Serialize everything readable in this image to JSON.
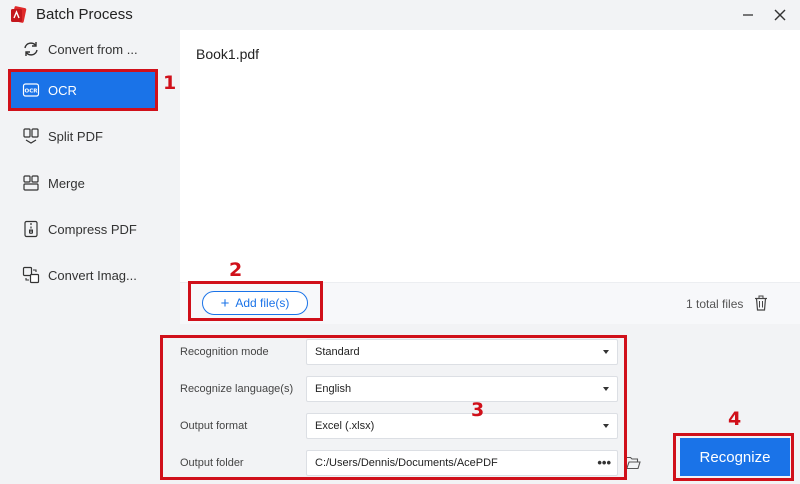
{
  "window": {
    "title": "Batch Process",
    "icons": {
      "logo": "app-logo-icon",
      "minimize": "minimize-icon",
      "close": "close-icon"
    }
  },
  "sidebar": {
    "items": [
      {
        "label": "Convert from ...",
        "icon": "convert-from-icon",
        "active": false
      },
      {
        "label": "OCR",
        "icon": "ocr-icon",
        "active": true
      },
      {
        "label": "Split PDF",
        "icon": "split-pdf-icon",
        "active": false
      },
      {
        "label": "Merge",
        "icon": "merge-icon",
        "active": false
      },
      {
        "label": "Compress PDF",
        "icon": "compress-pdf-icon",
        "active": false
      },
      {
        "label": "Convert Imag...",
        "icon": "convert-image-icon",
        "active": false
      }
    ]
  },
  "files": {
    "list": [
      "Book1.pdf"
    ],
    "add_label": "Add file(s)",
    "total": "1 total files"
  },
  "options": {
    "recognition_mode": {
      "label": "Recognition mode",
      "value": "Standard"
    },
    "language": {
      "label": "Recognize language(s)",
      "value": "English"
    },
    "output_format": {
      "label": "Output format",
      "value": "Excel (.xlsx)"
    },
    "output_folder": {
      "label": "Output folder",
      "value": "C:/Users/Dennis/Documents/AcePDF"
    }
  },
  "actions": {
    "recognize_label": "Recognize"
  },
  "annotations": [
    "1",
    "2",
    "3",
    "4"
  ],
  "colors": {
    "accent": "#1a73e8",
    "annotation": "#d0101a",
    "panel": "#ffffff",
    "background": "#f2f3f5"
  }
}
